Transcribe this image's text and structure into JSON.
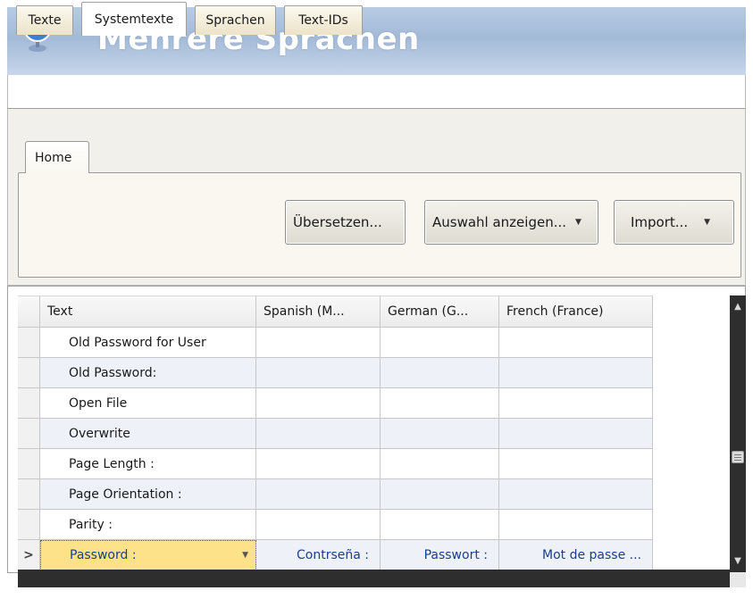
{
  "window": {
    "title": "Mehrere Sprachen"
  },
  "tabs": [
    {
      "label": "Texte"
    },
    {
      "label": "Systemtexte",
      "active": true
    },
    {
      "label": "Sprachen"
    },
    {
      "label": "Text-IDs"
    }
  ],
  "ribbon": {
    "tab_label": "Home",
    "buttons": {
      "translate": "Übersetzen...",
      "show_selection": "Auswahl anzeigen...",
      "import": "Import..."
    }
  },
  "grid": {
    "columns": [
      "Text",
      "Spanish (M...",
      "German (G...",
      "French (France)"
    ],
    "rows": [
      {
        "text": "Old Password for User",
        "spanish": "",
        "german": "",
        "french": ""
      },
      {
        "text": "Old Password:",
        "spanish": "",
        "german": "",
        "french": ""
      },
      {
        "text": "Open File",
        "spanish": "",
        "german": "",
        "french": ""
      },
      {
        "text": "Overwrite",
        "spanish": "",
        "german": "",
        "french": ""
      },
      {
        "text": "Page Length :",
        "spanish": "",
        "german": "",
        "french": ""
      },
      {
        "text": "Page Orientation :",
        "spanish": "",
        "german": "",
        "french": ""
      },
      {
        "text": "Parity :",
        "spanish": "",
        "german": "",
        "french": ""
      },
      {
        "text": "Password :",
        "spanish": "Contrseña :",
        "german": "Passwort :",
        "french": "Mot de passe ...",
        "selected": true
      }
    ],
    "current_row_marker": ">"
  },
  "colors": {
    "title_gradient": "#a3bad7",
    "selected_cell": "#fde28a",
    "value_text": "#1c3d8a",
    "scrollbar": "#2e2e2e"
  }
}
